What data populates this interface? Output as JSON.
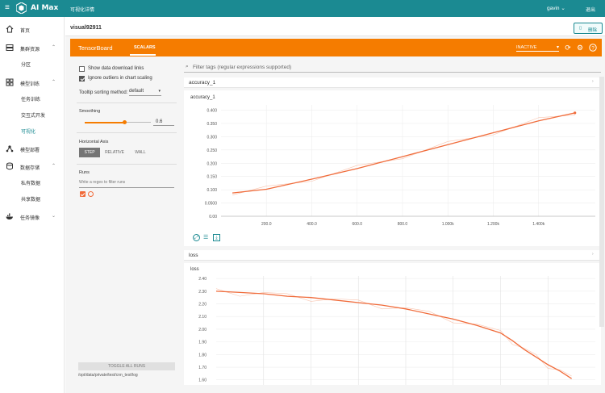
{
  "topbar": {
    "app_name": "AI Max",
    "breadcrumb": "可视化详情",
    "user": "gavin",
    "logout": "退出"
  },
  "sidebar": {
    "items": [
      {
        "label": "首页",
        "icon": "home-icon"
      },
      {
        "label": "集群资源",
        "icon": "storage-icon"
      },
      {
        "label": "模型训练",
        "icon": "grid-icon"
      },
      {
        "label": "模型部署",
        "icon": "network-icon"
      },
      {
        "label": "数据存储",
        "icon": "database-icon"
      },
      {
        "label": "任务镜像",
        "icon": "docker-icon"
      }
    ],
    "subs": {
      "partition": "分区",
      "train_task": "任务训练",
      "interactive": "交互式开发",
      "visual": "可视化",
      "private_data": "私有数据",
      "shared_data": "共享数据"
    }
  },
  "header": {
    "title": "visual92911",
    "delete": "删除"
  },
  "tensorboard": {
    "name": "TensorBoard",
    "tab": "SCALARS",
    "status": "INACTIVE"
  },
  "left": {
    "show_download": "Show data download links",
    "ignore_outliers": "Ignore outliers in chart scaling",
    "tooltip_label": "Tooltip sorting method:",
    "tooltip_value": "default",
    "smoothing_label": "Smoothing",
    "smoothing_value": "0.6",
    "smoothing": 0.6,
    "axis_label": "Horizontal Axis",
    "axis_step": "STEP",
    "axis_relative": "RELATIVE",
    "axis_wall": "WALL",
    "runs_label": "Runs",
    "runs_placeholder": "Write a regex to filter runs",
    "toggle": "TOGGLE ALL RUNS",
    "logdir": "/opt/data/private/test/cnn_test/log"
  },
  "filter_placeholder": "Filter tags (regular expressions supported)",
  "accuracy": {
    "section": "accuracy_1",
    "card_title": "accuracy_1"
  },
  "loss": {
    "section": "loss",
    "card_title": "loss"
  },
  "colors": {
    "accent": "#f57c00",
    "teal": "#1b8a92",
    "series": "#f06b3a"
  },
  "chart_data": [
    {
      "type": "line",
      "title": "accuracy_1",
      "x": [
        50,
        200,
        400,
        600,
        800,
        1000,
        1200,
        1400,
        1560
      ],
      "series": [
        {
          "values": [
            0.088,
            0.102,
            0.14,
            0.18,
            0.225,
            0.27,
            0.315,
            0.36,
            0.39
          ]
        }
      ],
      "xticks": [
        "200.0",
        "400.0",
        "600.0",
        "800.0",
        "1.000k",
        "1.200k",
        "1.400k"
      ],
      "yticks": [
        "0.00",
        "0.0500",
        "0.100",
        "0.150",
        "0.200",
        "0.250",
        "0.300",
        "0.350",
        "0.400"
      ],
      "xlim": [
        0,
        1650
      ],
      "ylim": [
        0,
        0.42
      ]
    },
    {
      "type": "line",
      "title": "loss",
      "x": [
        0,
        100,
        200,
        300,
        400,
        500,
        600,
        700,
        800,
        900,
        1000,
        1100,
        1200,
        1250,
        1300,
        1350,
        1400,
        1450,
        1500
      ],
      "series": [
        {
          "values": [
            2.3,
            2.29,
            2.28,
            2.26,
            2.25,
            2.23,
            2.21,
            2.19,
            2.16,
            2.12,
            2.08,
            2.03,
            1.97,
            1.91,
            1.84,
            1.78,
            1.72,
            1.67,
            1.61
          ]
        }
      ],
      "yticks": [
        "2.40",
        "2.30",
        "2.20",
        "2.10",
        "2.00",
        "1.90",
        "1.80",
        "1.70",
        "1.60"
      ],
      "xlim": [
        0,
        1600
      ],
      "ylim": [
        1.56,
        2.42
      ]
    }
  ]
}
